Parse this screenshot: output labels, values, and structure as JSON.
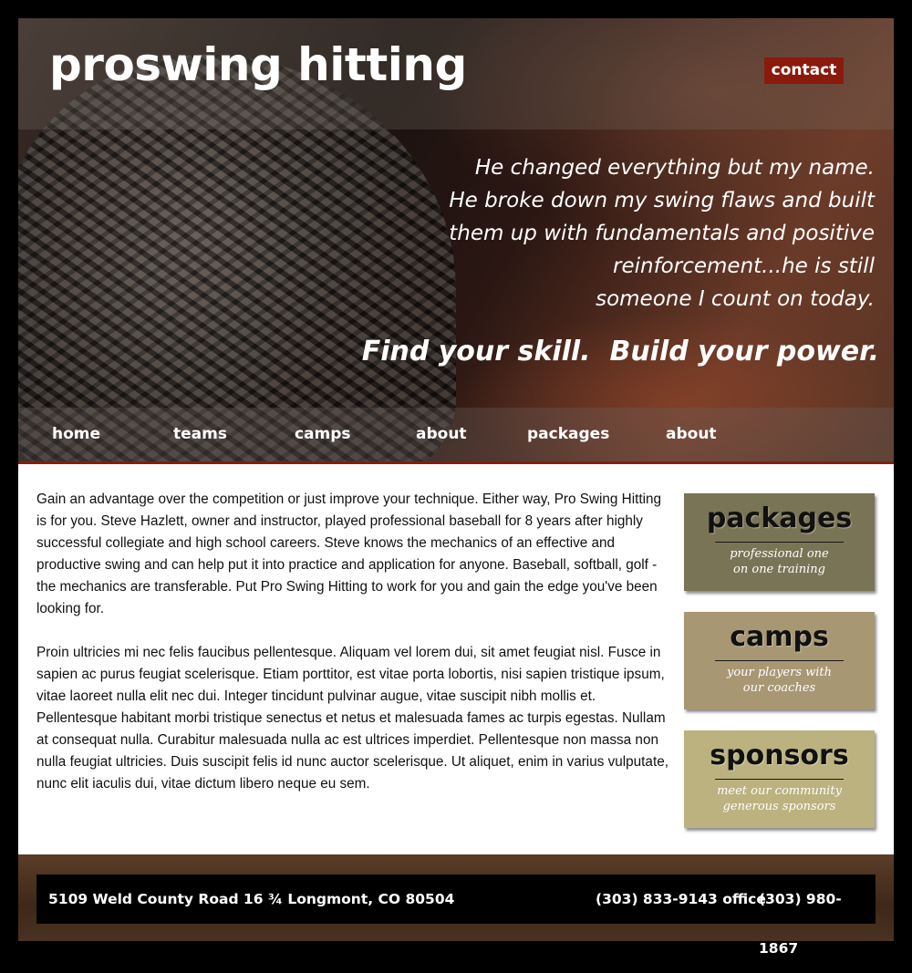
{
  "header": {
    "brand": "proswing hitting",
    "contact_label": "contact"
  },
  "hero": {
    "quote_lines": [
      "He changed everything but my name.",
      "He broke down my swing flaws and built",
      "them up with fundamentals and positive",
      "reinforcement...he is still",
      "someone I count on today."
    ],
    "tagline": "Find your skill.  Build your power."
  },
  "nav": {
    "items": [
      {
        "label": "home"
      },
      {
        "label": "teams"
      },
      {
        "label": "camps"
      },
      {
        "label": "about"
      },
      {
        "label": "packages"
      },
      {
        "label": "about"
      }
    ]
  },
  "content": {
    "paragraphs": [
      "Gain an advantage over the competition or just improve your technique. Either way, Pro Swing Hitting is for you. Steve Hazlett, owner and instructor, played professional baseball for 8 years after highly successful collegiate and high school careers. Steve knows the mechanics of an effective and productive swing and can help put it into practice and application for anyone. Baseball, softball, golf - the mechanics are transferable. Put Pro Swing Hitting to work for you and gain the edge you've been looking for.",
      "Proin ultricies mi nec felis faucibus pellentesque. Aliquam vel lorem dui, sit amet feugiat nisl. Fusce in sapien ac purus feugiat scelerisque. Etiam porttitor, est vitae porta lobortis, nisi sapien tristique ipsum, vitae laoreet nulla elit nec dui. Integer tincidunt pulvinar augue, vitae suscipit nibh mollis et. Pellentesque habitant morbi tristique senectus et netus et malesuada fames ac turpis egestas. Nullam at consequat nulla. Curabitur malesuada nulla ac est ultrices imperdiet. Pellentesque non massa non nulla feugiat ultricies. Duis suscipit felis id nunc auctor scelerisque. Ut aliquet, enim in varius vulputate, nunc elit iaculis dui, vitae dictum libero neque eu sem."
    ]
  },
  "promos": [
    {
      "title": "packages",
      "desc_line1": "professional one",
      "desc_line2": "on one training",
      "color": "#7a7456"
    },
    {
      "title": "camps",
      "desc_line1": "your players with",
      "desc_line2": "our coaches",
      "color": "#a89773"
    },
    {
      "title": "sponsors",
      "desc_line1": "meet our community",
      "desc_line2": "generous sponsors",
      "color": "#bbb27f"
    }
  ],
  "footer": {
    "address": "5109 Weld County Road 16 ¾ Longmont, CO 80504",
    "phone_office": "(303) 833-9143 office",
    "phone_other": "(303) 980-1867"
  },
  "colors": {
    "accent_red": "#8a1a0c",
    "footer_brown": "#4a3222"
  }
}
